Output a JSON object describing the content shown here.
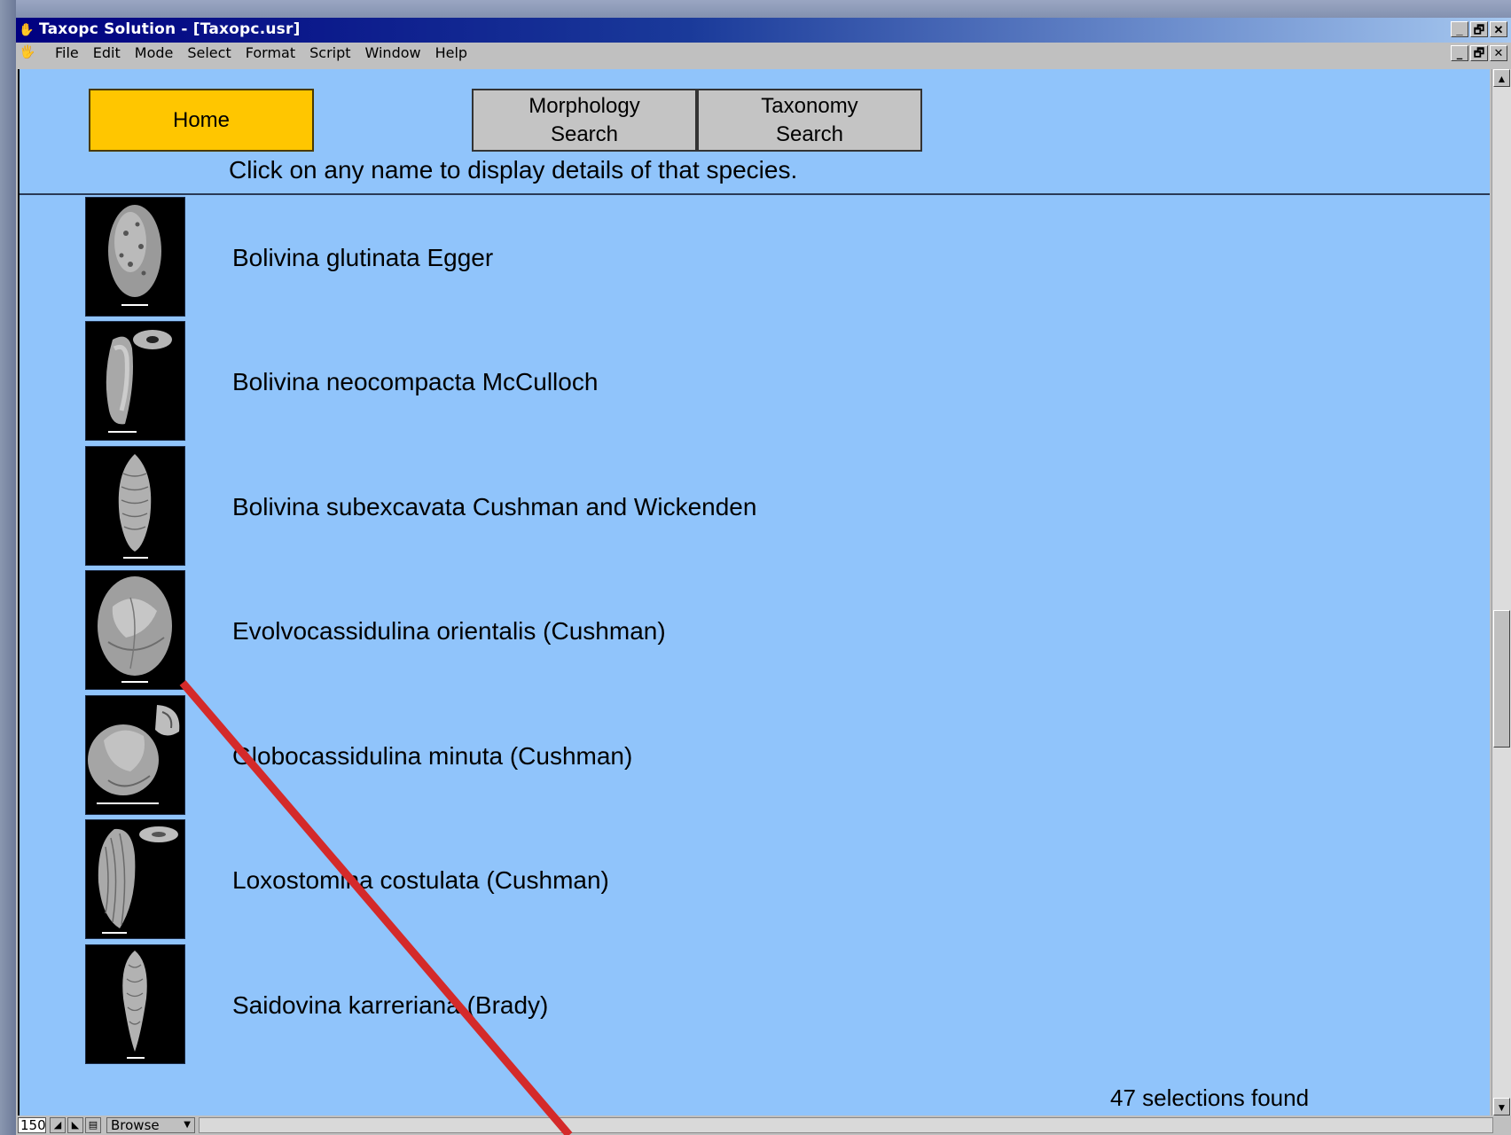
{
  "window": {
    "title": "Taxopc Solution - [Taxopc.usr]",
    "controls": [
      "_",
      "🗗",
      "✕"
    ]
  },
  "menubar": {
    "items": [
      "File",
      "Edit",
      "Mode",
      "Select",
      "Format",
      "Script",
      "Window",
      "Help"
    ]
  },
  "nav": {
    "home_label": "Home",
    "morphology_label": "Morphology Search",
    "taxonomy_label": "Taxonomy Search"
  },
  "instruction": "Click on any name to display details of that species.",
  "species": [
    {
      "name": "Bolivina glutinata Egger",
      "thumb_icon": "foraminifera-specimen-icon"
    },
    {
      "name": "Bolivina neocompacta McCulloch",
      "thumb_icon": "foraminifera-specimen-icon"
    },
    {
      "name": "Bolivina subexcavata Cushman and Wickenden",
      "thumb_icon": "foraminifera-specimen-icon"
    },
    {
      "name": "Evolvocassidulina orientalis (Cushman)",
      "thumb_icon": "foraminifera-specimen-icon"
    },
    {
      "name": "Globocassidulina minuta (Cushman)",
      "thumb_icon": "foraminifera-specimen-icon"
    },
    {
      "name": "Loxostomina costulata (Cushman)",
      "thumb_icon": "foraminifera-specimen-icon"
    },
    {
      "name": "Saidovina karreriana (Brady)",
      "thumb_icon": "foraminifera-specimen-icon"
    }
  ],
  "results": "47 selections found",
  "statusbar": {
    "zoom": "150",
    "mode": "Browse"
  },
  "colors": {
    "content_bg": "#90c4fb",
    "home_button": "#ffc600",
    "nav_button": "#c4c4c4",
    "annotation_slash": "#d42a2a"
  }
}
